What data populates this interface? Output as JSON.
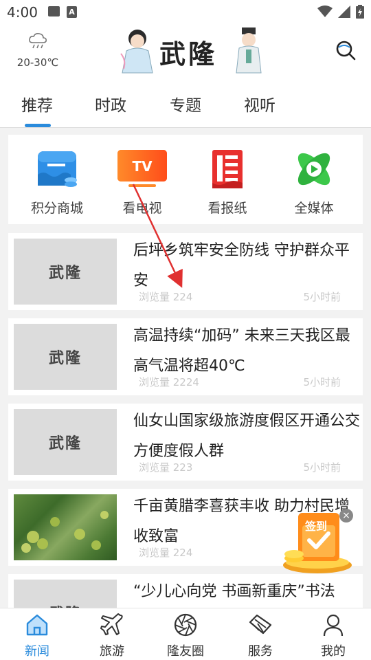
{
  "status_bar": {
    "time": "4:00"
  },
  "header": {
    "weather_temp": "20-30℃",
    "logo_text": "武隆",
    "colors": {
      "accent": "#2a8bdc"
    }
  },
  "tabs": [
    {
      "label": "推荐",
      "active": true
    },
    {
      "label": "时政"
    },
    {
      "label": "专题"
    },
    {
      "label": "视听"
    }
  ],
  "quick_links": [
    {
      "label": "积分商城",
      "icon": "store-icon"
    },
    {
      "label": "看电视",
      "icon": "tv-icon",
      "icon_text": "TV"
    },
    {
      "label": "看报纸",
      "icon": "newspaper-icon"
    },
    {
      "label": "全媒体",
      "icon": "media-play-icon"
    }
  ],
  "news": [
    {
      "title": "后坪乡筑牢安全防线 守护群众平安",
      "views": "浏览量 224",
      "time": "5小时前",
      "thumb_text": "武隆"
    },
    {
      "title": "高温持续“加码” 未来三天我区最高气温将超40℃",
      "views": "浏览量 2224",
      "time": "5小时前",
      "thumb_text": "武隆"
    },
    {
      "title": "仙女山国家级旅游度假区开通公交方便度假人群",
      "views": "浏览量 223",
      "time": "5小时前",
      "thumb_text": "武隆"
    },
    {
      "title": "千亩黄腊李喜获丰收 助力村民增收致富",
      "views": "浏览量 224",
      "time": "",
      "thumb_text": ""
    },
    {
      "title": "“少儿心向党 书画新重庆”书法",
      "views": "",
      "time": "",
      "thumb_text": "武隆"
    }
  ],
  "sign_in": {
    "label": "签到"
  },
  "bottom_nav": [
    {
      "label": "新闻",
      "icon": "home-icon",
      "active": true
    },
    {
      "label": "旅游",
      "icon": "plane-icon"
    },
    {
      "label": "隆友圈",
      "icon": "aperture-icon"
    },
    {
      "label": "服务",
      "icon": "handshake-icon"
    },
    {
      "label": "我的",
      "icon": "user-icon"
    }
  ]
}
